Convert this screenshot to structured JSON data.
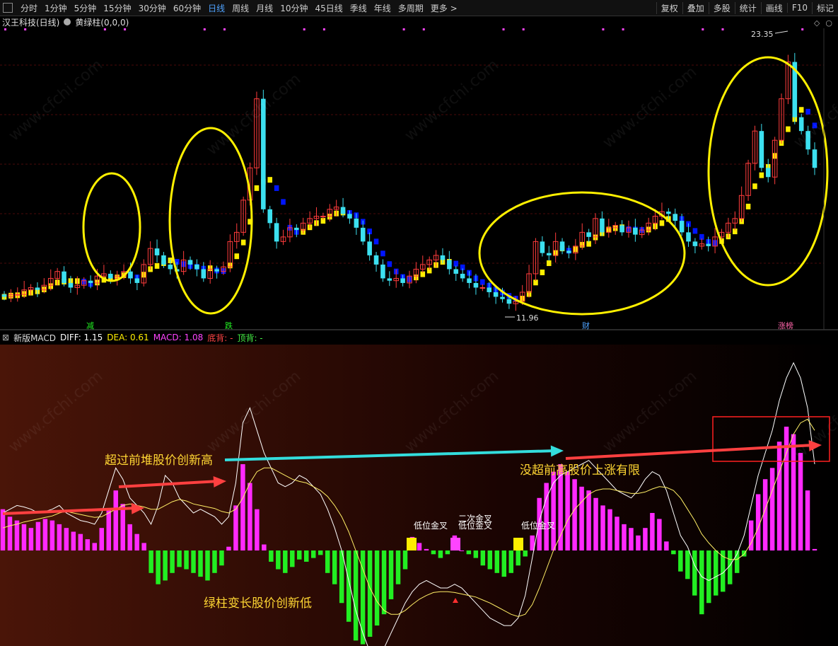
{
  "toolbar": {
    "tabs": [
      "分时",
      "1分钟",
      "5分钟",
      "15分钟",
      "30分钟",
      "60分钟",
      "日线",
      "周线",
      "月线",
      "10分钟",
      "45日线",
      "季线",
      "年线",
      "多周期",
      "更多 >"
    ],
    "active": "日线",
    "right": [
      "复权",
      "叠加",
      "多股",
      "统计",
      "画线",
      "F10",
      "标记"
    ]
  },
  "info": {
    "stock": "汉王科技(日线)",
    "indicator": "黄绿柱(0,0,0)"
  },
  "macd_info": {
    "name": "新版MACD",
    "diff": "DIFF: 1.15",
    "dea": "DEA: 0.61",
    "macd": "MACD: 1.08",
    "bottom": "底背: -",
    "top": "顶背: -"
  },
  "colors": {
    "up": "#ff3c3c",
    "down": "#3ce0f0",
    "yellow_line": "#ffee00",
    "blue_line": "#0015ff",
    "macd_pos": "#ff2aff",
    "macd_neg": "#22ee22",
    "diff": "#ffffff",
    "dea": "#ffee66",
    "circle": "#fff000",
    "annotation": "#ffd633",
    "white_text": "#ffffff",
    "arrow_red": "#ff4040",
    "arrow_cyan": "#33dddd",
    "box_red": "#ff2020",
    "label_green": "#22ee22",
    "label_blue": "#4fa3ff",
    "label_pink": "#ff66aa"
  },
  "price_labels": {
    "high": "23.35",
    "low": "11.96"
  },
  "bottom_markers": [
    "减",
    "跌",
    "财",
    "涨榜"
  ],
  "macd_labels": [
    "低位金叉",
    "二次金叉",
    "低位金叉",
    "低位金叉"
  ],
  "annotations": [
    "超过前堆股价创新高",
    "没超前高股价上涨有限",
    "绿柱变长股价创新低"
  ],
  "watermark": "www.cfchi.com",
  "chart_data": [
    {
      "type": "candlestick",
      "title": "汉王科技(日线)",
      "series": [
        {
          "name": "candles",
          "o": [
            12.5,
            12.4,
            12.5,
            12.5,
            12.7,
            12.8,
            12.7,
            12.9,
            13.2,
            13.5,
            13.0,
            12.8,
            12.9,
            13.1,
            13.0,
            13.3,
            13.4,
            13.2,
            13.3,
            13.5,
            13.2,
            13.0,
            13.8,
            14.5,
            14.2,
            13.8,
            13.6,
            13.5,
            14.0,
            13.8,
            13.6,
            13.2,
            13.6,
            13.5,
            13.7,
            14.8,
            15.2,
            16.6,
            18.0,
            21.0,
            16.2,
            15.6,
            14.8,
            15.0,
            15.4,
            15.3,
            15.6,
            15.8,
            15.9,
            15.9,
            16.2,
            16.3,
            16.0,
            15.8,
            15.4,
            14.8,
            14.2,
            13.8,
            13.2,
            13.1,
            13.2,
            13.0,
            13.3,
            13.6,
            13.8,
            14.0,
            14.2,
            14.0,
            13.6,
            13.4,
            13.2,
            13.0,
            12.8,
            12.8,
            12.6,
            12.4,
            12.3,
            12.1,
            12.2,
            12.6,
            13.4,
            14.8,
            14.3,
            14.2,
            14.8,
            14.4,
            14.3,
            14.6,
            15.2,
            15.0,
            15.8,
            15.2,
            15.4,
            15.5,
            15.2,
            15.4,
            15.1,
            15.3,
            15.6,
            15.9,
            16.1,
            16.0,
            15.7,
            15.2,
            14.8,
            14.6,
            14.7,
            14.6,
            15.0,
            15.2,
            15.6,
            15.8,
            16.8,
            18.2,
            19.6,
            18.0,
            17.6,
            19.2,
            21.0,
            22.6,
            20.2,
            19.6,
            18.8
          ]
        },
        {
          "name": "close",
          "c": [
            12.4,
            12.5,
            12.5,
            12.7,
            12.8,
            12.7,
            12.9,
            13.2,
            13.5,
            13.0,
            12.8,
            12.9,
            13.1,
            13.0,
            13.3,
            13.4,
            13.2,
            13.3,
            13.5,
            13.2,
            13.0,
            13.8,
            14.5,
            14.2,
            13.8,
            13.6,
            13.5,
            14.0,
            13.8,
            13.6,
            13.2,
            13.6,
            13.5,
            13.7,
            14.8,
            15.2,
            16.6,
            18.0,
            21.0,
            16.2,
            15.6,
            14.8,
            15.0,
            15.4,
            15.3,
            15.6,
            15.8,
            15.9,
            15.9,
            16.2,
            16.3,
            16.0,
            15.8,
            15.4,
            14.8,
            14.2,
            13.8,
            13.2,
            13.1,
            13.2,
            13.0,
            13.3,
            13.6,
            13.8,
            14.0,
            14.2,
            14.0,
            13.6,
            13.4,
            13.2,
            13.0,
            12.8,
            12.8,
            12.6,
            12.4,
            12.3,
            12.1,
            12.2,
            12.6,
            13.4,
            14.8,
            14.3,
            14.2,
            14.8,
            14.4,
            14.3,
            14.6,
            15.2,
            15.0,
            15.8,
            15.2,
            15.4,
            15.5,
            15.2,
            15.4,
            15.1,
            15.3,
            15.6,
            15.9,
            16.1,
            16.0,
            15.7,
            15.2,
            14.8,
            14.6,
            14.7,
            14.6,
            15.0,
            15.2,
            15.6,
            15.8,
            16.8,
            18.2,
            19.6,
            18.0,
            17.6,
            19.2,
            21.0,
            22.6,
            20.2,
            19.6,
            18.8,
            18.0
          ]
        }
      ],
      "high": 23.35,
      "low": 11.96,
      "ylim": [
        11.4,
        24.0
      ]
    },
    {
      "type": "bar",
      "title": "新版MACD",
      "series": [
        {
          "name": "MACD",
          "values": [
            0.55,
            0.45,
            0.4,
            0.35,
            0.3,
            0.38,
            0.42,
            0.4,
            0.35,
            0.3,
            0.25,
            0.22,
            0.15,
            0.1,
            0.3,
            0.55,
            0.8,
            0.62,
            0.35,
            0.22,
            0.1,
            -0.3,
            -0.45,
            -0.4,
            -0.3,
            -0.22,
            -0.25,
            -0.3,
            -0.35,
            -0.4,
            -0.3,
            -0.2,
            0.05,
            0.6,
            1.15,
            0.9,
            0.55,
            0.08,
            -0.15,
            -0.25,
            -0.3,
            -0.22,
            -0.12,
            -0.15,
            -0.1,
            -0.06,
            -0.3,
            -0.45,
            -0.7,
            -0.95,
            -1.2,
            -1.25,
            -1.15,
            -1.0,
            -0.85,
            -0.65,
            -0.45,
            -0.25,
            0.18,
            0.1,
            0.02,
            -0.05,
            -0.1,
            -0.05,
            0.2,
            0.0,
            -0.05,
            -0.1,
            -0.2,
            -0.25,
            -0.3,
            -0.35,
            -0.3,
            -0.2,
            -0.08,
            0.2,
            0.7,
            0.9,
            1.05,
            1.15,
            1.05,
            0.95,
            0.85,
            0.8,
            0.7,
            0.6,
            0.55,
            0.45,
            0.35,
            0.3,
            0.2,
            0.3,
            0.5,
            0.42,
            0.12,
            -0.05,
            -0.28,
            -0.38,
            -0.6,
            -0.85,
            -0.7,
            -0.6,
            -0.55,
            -0.45,
            -0.3,
            -0.08,
            0.4,
            0.75,
            0.95,
            1.1,
            1.45,
            1.65,
            1.55,
            1.3,
            0.8,
            0.02
          ]
        },
        {
          "name": "DIFF",
          "values": [
            0.5,
            0.55,
            0.6,
            0.58,
            0.55,
            0.5,
            0.52,
            0.55,
            0.6,
            0.5,
            0.45,
            0.4,
            0.38,
            0.35,
            0.5,
            0.8,
            1.1,
            0.95,
            0.7,
            0.6,
            0.5,
            0.35,
            0.6,
            1.0,
            0.9,
            0.7,
            0.6,
            0.5,
            0.55,
            0.5,
            0.45,
            0.35,
            0.45,
            0.9,
            1.7,
            1.9,
            1.6,
            1.3,
            1.1,
            0.9,
            0.85,
            0.9,
            1.0,
            0.95,
            0.85,
            0.75,
            0.55,
            0.3,
            0.0,
            -0.4,
            -0.8,
            -1.1,
            -1.35,
            -1.4,
            -1.3,
            -1.1,
            -0.9,
            -0.7,
            -0.55,
            -0.45,
            -0.4,
            -0.45,
            -0.5,
            -0.5,
            -0.45,
            -0.5,
            -0.6,
            -0.7,
            -0.8,
            -0.9,
            -0.95,
            -1.0,
            -1.0,
            -0.9,
            -0.6,
            -0.1,
            0.4,
            0.7,
            0.9,
            1.0,
            1.05,
            1.1,
            1.15,
            1.2,
            1.1,
            1.0,
            0.9,
            0.8,
            0.75,
            0.7,
            0.8,
            0.95,
            1.05,
            1.0,
            0.8,
            0.5,
            0.2,
            0.05,
            -0.2,
            -0.35,
            -0.4,
            -0.35,
            -0.3,
            -0.2,
            -0.05,
            0.2,
            0.6,
            1.0,
            1.3,
            1.6,
            2.0,
            2.3,
            2.5,
            2.3,
            1.9,
            1.15
          ]
        },
        {
          "name": "DEA",
          "values": [
            0.3,
            0.33,
            0.35,
            0.38,
            0.4,
            0.42,
            0.44,
            0.46,
            0.5,
            0.52,
            0.5,
            0.48,
            0.46,
            0.44,
            0.45,
            0.5,
            0.55,
            0.6,
            0.62,
            0.6,
            0.58,
            0.55,
            0.55,
            0.6,
            0.65,
            0.68,
            0.66,
            0.62,
            0.6,
            0.58,
            0.56,
            0.52,
            0.5,
            0.55,
            0.7,
            0.9,
            1.05,
            1.1,
            1.1,
            1.05,
            1.0,
            0.95,
            0.92,
            0.9,
            0.85,
            0.8,
            0.72,
            0.6,
            0.45,
            0.25,
            0.0,
            -0.25,
            -0.5,
            -0.68,
            -0.8,
            -0.85,
            -0.85,
            -0.8,
            -0.72,
            -0.65,
            -0.6,
            -0.56,
            -0.55,
            -0.55,
            -0.56,
            -0.58,
            -0.6,
            -0.62,
            -0.66,
            -0.7,
            -0.75,
            -0.8,
            -0.85,
            -0.88,
            -0.85,
            -0.72,
            -0.5,
            -0.25,
            0.0,
            0.2,
            0.4,
            0.55,
            0.65,
            0.75,
            0.8,
            0.82,
            0.82,
            0.8,
            0.78,
            0.76,
            0.76,
            0.78,
            0.82,
            0.85,
            0.84,
            0.8,
            0.7,
            0.55,
            0.4,
            0.22,
            0.1,
            0.0,
            -0.08,
            -0.12,
            -0.12,
            -0.05,
            0.1,
            0.3,
            0.55,
            0.8,
            1.05,
            1.3,
            1.55,
            1.7,
            1.75,
            1.6
          ]
        }
      ],
      "ylim": [
        -1.6,
        2.7
      ]
    }
  ]
}
